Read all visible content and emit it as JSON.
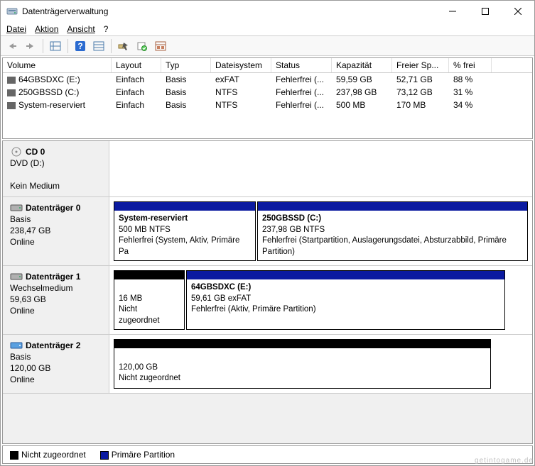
{
  "window": {
    "title": "Datenträgerverwaltung"
  },
  "menu": {
    "file": "Datei",
    "action": "Aktion",
    "view": "Ansicht",
    "help": "?"
  },
  "columns": {
    "volume": "Volume",
    "layout": "Layout",
    "type": "Typ",
    "fs": "Dateisystem",
    "status": "Status",
    "capacity": "Kapazität",
    "free": "Freier Sp...",
    "pct": "% frei"
  },
  "volumes": [
    {
      "name": "64GBSDXC (E:)",
      "layout": "Einfach",
      "type": "Basis",
      "fs": "exFAT",
      "status": "Fehlerfrei (...",
      "capacity": "59,59 GB",
      "free": "52,71 GB",
      "pct": "88 %"
    },
    {
      "name": "250GBSSD (C:)",
      "layout": "Einfach",
      "type": "Basis",
      "fs": "NTFS",
      "status": "Fehlerfrei (...",
      "capacity": "237,98 GB",
      "free": "73,12 GB",
      "pct": "31 %"
    },
    {
      "name": "System-reserviert",
      "layout": "Einfach",
      "type": "Basis",
      "fs": "NTFS",
      "status": "Fehlerfrei (...",
      "capacity": "500 MB",
      "free": "170 MB",
      "pct": "34 %"
    }
  ],
  "disks": {
    "cd": {
      "title": "CD 0",
      "line1": "DVD (D:)",
      "line2": "",
      "line3": "Kein Medium"
    },
    "d0": {
      "title": "Datenträger 0",
      "type": "Basis",
      "size": "238,47 GB",
      "state": "Online",
      "p1": {
        "name": "System-reserviert",
        "sub": "500 MB NTFS",
        "status": "Fehlerfrei (System, Aktiv, Primäre Pa",
        "color": "#0b1aa0"
      },
      "p2": {
        "name": "250GBSSD  (C:)",
        "sub": "237,98 GB NTFS",
        "status": "Fehlerfrei (Startpartition, Auslagerungsdatei, Absturzabbild, Primäre Partition)",
        "color": "#0b1aa0"
      }
    },
    "d1": {
      "title": "Datenträger 1",
      "type": "Wechselmedium",
      "size": "59,63 GB",
      "state": "Online",
      "p1": {
        "name": "",
        "sub": "16 MB",
        "status": "Nicht zugeordnet",
        "color": "#000000"
      },
      "p2": {
        "name": "64GBSDXC  (E:)",
        "sub": "59,61 GB exFAT",
        "status": "Fehlerfrei (Aktiv, Primäre Partition)",
        "color": "#0b1aa0"
      }
    },
    "d2": {
      "title": "Datenträger 2",
      "type": "Basis",
      "size": "120,00 GB",
      "state": "Online",
      "p1": {
        "name": "",
        "sub": "120,00 GB",
        "status": "Nicht zugeordnet",
        "color": "#000000"
      }
    }
  },
  "legend": {
    "unalloc": "Nicht zugeordnet",
    "primary": "Primäre Partition"
  },
  "colors": {
    "unalloc": "#000000",
    "primary": "#0b1aa0"
  },
  "watermark": "getintogame.de"
}
